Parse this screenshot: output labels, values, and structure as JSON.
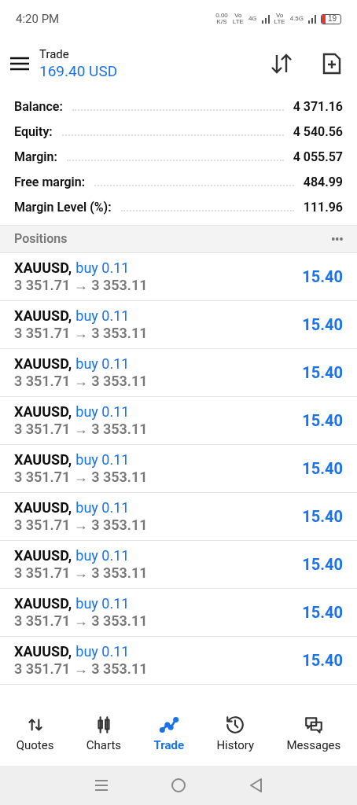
{
  "status_bar": {
    "time": "4:20 PM",
    "speed": "0.00",
    "speed_unit": "K/S",
    "sim1_volte": [
      "Vo",
      "LTE"
    ],
    "sim1_network": "4G",
    "sim2_volte": [
      "Vo",
      "LTE"
    ],
    "sim2_network": "4.5G",
    "battery": {
      "text": "19",
      "level": 0.19
    }
  },
  "header": {
    "title": "Trade",
    "subtitle": "169.40 USD"
  },
  "summary": [
    {
      "label": "Balance:",
      "value": "4 371.16"
    },
    {
      "label": "Equity:",
      "value": "4 540.56"
    },
    {
      "label": "Margin:",
      "value": "4 055.57"
    },
    {
      "label": "Free margin:",
      "value": "484.99"
    },
    {
      "label": "Margin Level (%):",
      "value": "111.96"
    }
  ],
  "positions": {
    "title": "Positions",
    "more": "•••",
    "rows": [
      {
        "symbol": "XAUUSD,",
        "side": "buy 0.11",
        "prices": "3 351.71 → 3 353.11",
        "profit": "15.40"
      },
      {
        "symbol": "XAUUSD,",
        "side": "buy 0.11",
        "prices": "3 351.71 → 3 353.11",
        "profit": "15.40"
      },
      {
        "symbol": "XAUUSD,",
        "side": "buy 0.11",
        "prices": "3 351.71 → 3 353.11",
        "profit": "15.40"
      },
      {
        "symbol": "XAUUSD,",
        "side": "buy 0.11",
        "prices": "3 351.71 → 3 353.11",
        "profit": "15.40"
      },
      {
        "symbol": "XAUUSD,",
        "side": "buy 0.11",
        "prices": "3 351.71 → 3 353.11",
        "profit": "15.40"
      },
      {
        "symbol": "XAUUSD,",
        "side": "buy 0.11",
        "prices": "3 351.71 → 3 353.11",
        "profit": "15.40"
      },
      {
        "symbol": "XAUUSD,",
        "side": "buy 0.11",
        "prices": "3 351.71 → 3 353.11",
        "profit": "15.40"
      },
      {
        "symbol": "XAUUSD,",
        "side": "buy 0.11",
        "prices": "3 351.71 → 3 353.11",
        "profit": "15.40"
      },
      {
        "symbol": "XAUUSD,",
        "side": "buy 0.11",
        "prices": "3 351.71 → 3 353.11",
        "profit": "15.40"
      }
    ]
  },
  "bottom_nav": [
    {
      "label": "Quotes",
      "kind": "quotes",
      "selected": false
    },
    {
      "label": "Charts",
      "kind": "charts",
      "selected": false
    },
    {
      "label": "Trade",
      "kind": "trade",
      "selected": true
    },
    {
      "label": "History",
      "kind": "history",
      "selected": false
    },
    {
      "label": "Messages",
      "kind": "messages",
      "selected": false
    }
  ]
}
